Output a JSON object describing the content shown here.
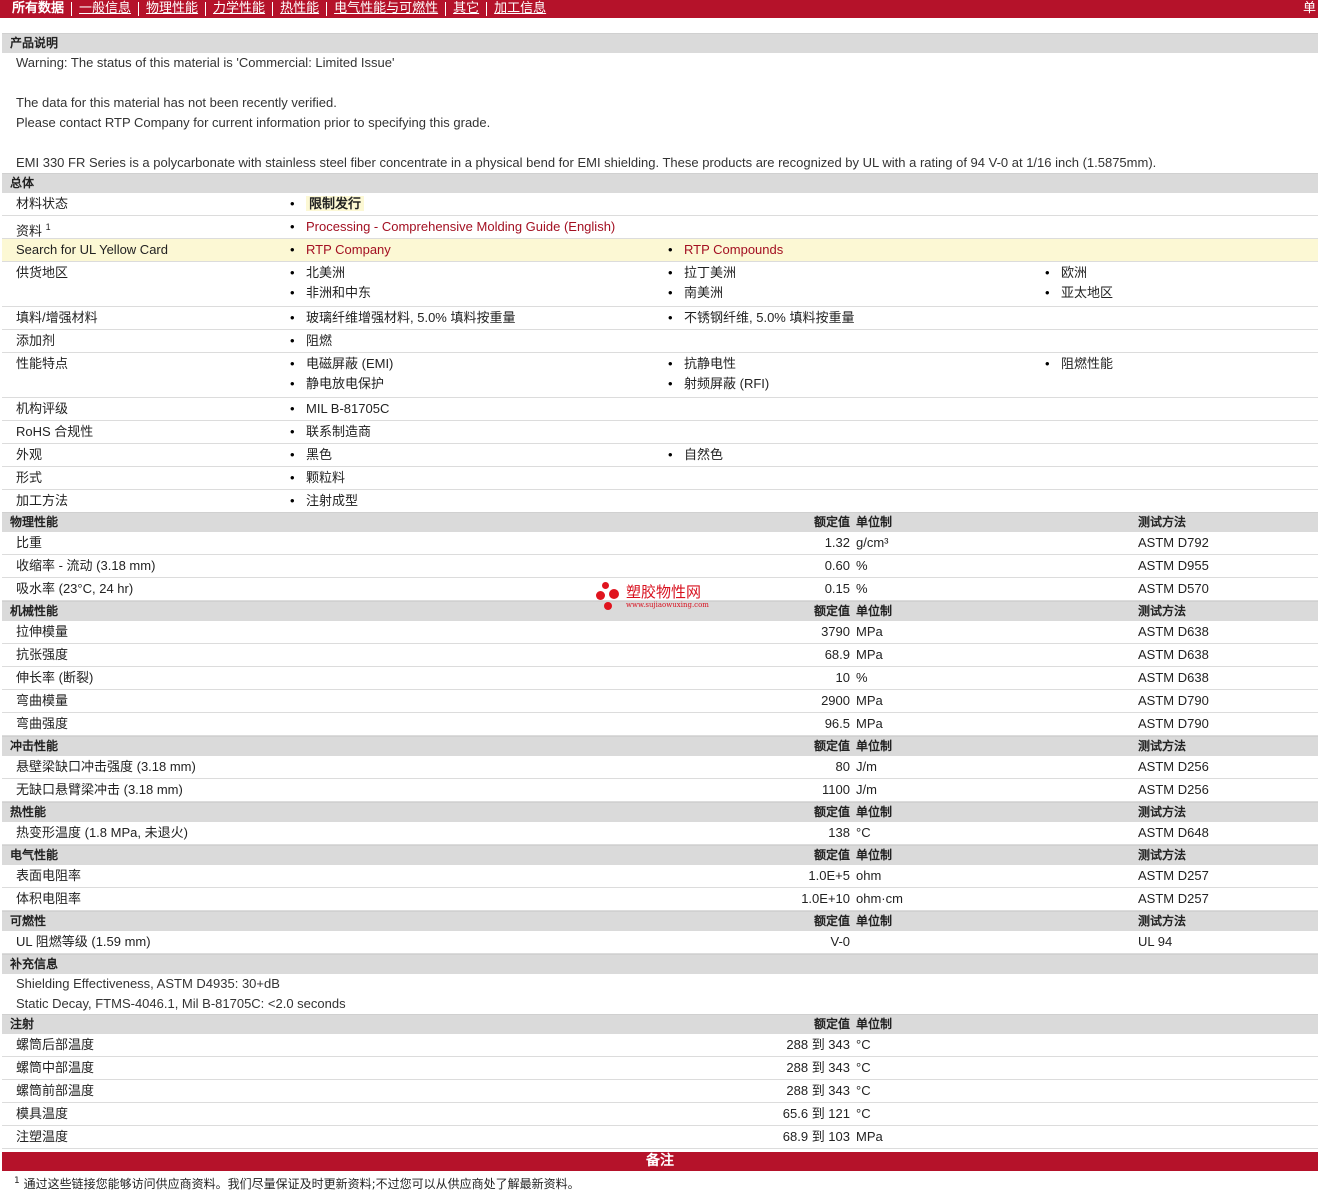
{
  "nav": {
    "items": [
      "所有数据",
      "一般信息",
      "物理性能",
      "力学性能",
      "热性能",
      "电气性能与可燃性",
      "其它",
      "加工信息"
    ],
    "edge": "单"
  },
  "product": {
    "title": "产品说明",
    "warning": "Warning: The status of this material is 'Commercial: Limited Issue'",
    "verify1": "The data for this material has not been recently verified.",
    "verify2": "Please contact RTP Company for current information prior to specifying this grade.",
    "description": "EMI 330 FR Series is a polycarbonate with stainless steel fiber concentrate in a physical bend for EMI shielding. These products are recognized by UL with a rating of 94 V-0 at 1/16 inch (1.5875mm)."
  },
  "general": {
    "title": "总体",
    "status_label": "材料状态",
    "status_value": "限制发行",
    "docs_label": "资料",
    "docs_sup": "1",
    "docs_link": "Processing - Comprehensive Molding Guide (English)",
    "ul_label": "Search for UL Yellow Card",
    "ul_link1": "RTP Company",
    "ul_link2": "RTP Compounds",
    "supply_label": "供货地区",
    "supply": [
      "北美洲",
      "拉丁美洲",
      "欧洲",
      "非洲和中东",
      "南美洲",
      "亚太地区"
    ],
    "filler_label": "填料/增强材料",
    "filler": [
      "玻璃纤维增强材料, 5.0% 填料按重量",
      "不锈钢纤维, 5.0% 填料按重量"
    ],
    "additive_label": "添加剂",
    "additive": "阻燃",
    "features_label": "性能特点",
    "features": [
      "电磁屏蔽 (EMI)",
      "抗静电性",
      "阻燃性能",
      "静电放电保护",
      "射频屏蔽 (RFI)"
    ],
    "agency_label": "机构评级",
    "agency": "MIL B-81705C",
    "rohs_label": "RoHS 合规性",
    "rohs": "联系制造商",
    "appearance_label": "外观",
    "appearance": [
      "黑色",
      "自然色"
    ],
    "form_label": "形式",
    "form": "颗粒料",
    "process_label": "加工方法",
    "process": "注射成型"
  },
  "headers": {
    "nominal": "额定值",
    "unit": "单位制",
    "test": "测试方法"
  },
  "physical": {
    "title": "物理性能",
    "rows": [
      {
        "label": "比重",
        "value": "1.32",
        "unit": "g/cm³",
        "test": "ASTM D792"
      },
      {
        "label": "收缩率 - 流动 (3.18 mm)",
        "value": "0.60",
        "unit": "%",
        "test": "ASTM D955"
      },
      {
        "label": "吸水率 (23°C, 24 hr)",
        "value": "0.15",
        "unit": "%",
        "test": "ASTM D570"
      }
    ]
  },
  "mechanical": {
    "title": "机械性能",
    "rows": [
      {
        "label": "拉伸模量",
        "value": "3790",
        "unit": "MPa",
        "test": "ASTM D638"
      },
      {
        "label": "抗张强度",
        "value": "68.9",
        "unit": "MPa",
        "test": "ASTM D638"
      },
      {
        "label": "伸长率 (断裂)",
        "value": "10",
        "unit": "%",
        "test": "ASTM D638"
      },
      {
        "label": "弯曲模量",
        "value": "2900",
        "unit": "MPa",
        "test": "ASTM D790"
      },
      {
        "label": "弯曲强度",
        "value": "96.5",
        "unit": "MPa",
        "test": "ASTM D790"
      }
    ]
  },
  "impact": {
    "title": "冲击性能",
    "rows": [
      {
        "label": "悬壁梁缺口冲击强度 (3.18 mm)",
        "value": "80",
        "unit": "J/m",
        "test": "ASTM D256"
      },
      {
        "label": "无缺口悬臂梁冲击 (3.18 mm)",
        "value": "1100",
        "unit": "J/m",
        "test": "ASTM D256"
      }
    ]
  },
  "thermal": {
    "title": "热性能",
    "rows": [
      {
        "label": "热变形温度 (1.8 MPa, 未退火)",
        "value": "138",
        "unit": "°C",
        "test": "ASTM D648"
      }
    ]
  },
  "electrical": {
    "title": "电气性能",
    "rows": [
      {
        "label": "表面电阻率",
        "value": "1.0E+5",
        "unit": "ohm",
        "test": "ASTM D257"
      },
      {
        "label": "体积电阻率",
        "value": "1.0E+10",
        "unit": "ohm·cm",
        "test": "ASTM D257"
      }
    ]
  },
  "flammability": {
    "title": "可燃性",
    "rows": [
      {
        "label": "UL 阻燃等级 (1.59 mm)",
        "value": "V-0",
        "unit": "",
        "test": "UL 94"
      }
    ]
  },
  "supplemental": {
    "title": "补充信息",
    "line1": "Shielding Effectiveness, ASTM D4935: 30+dB",
    "line2": "Static Decay, FTMS-4046.1, Mil B-81705C: <2.0 seconds"
  },
  "injection": {
    "title": "注射",
    "rows": [
      {
        "label": "螺筒后部温度",
        "value": "288 到  343",
        "unit": "°C"
      },
      {
        "label": "螺筒中部温度",
        "value": "288 到  343",
        "unit": "°C"
      },
      {
        "label": "螺筒前部温度",
        "value": "288 到  343",
        "unit": "°C"
      },
      {
        "label": "模具温度",
        "value": "65.6 到  121",
        "unit": "°C"
      },
      {
        "label": "注塑温度",
        "value": "68.9 到  103",
        "unit": "MPa"
      }
    ]
  },
  "watermark": {
    "name": "塑胶物性网",
    "url": "www.sujiaowuxing.com"
  },
  "notes": {
    "title": "备注",
    "footnote_sup": "1",
    "footnote": "通过这些链接您能够访问供应商资料。我们尽量保证及时更新资料;不过您可以从供应商处了解最新资料。"
  },
  "colors": {
    "brand": "#b5122a",
    "header_gray": "#dadada",
    "highlight": "#fcf8d4",
    "link": "#a31022"
  }
}
